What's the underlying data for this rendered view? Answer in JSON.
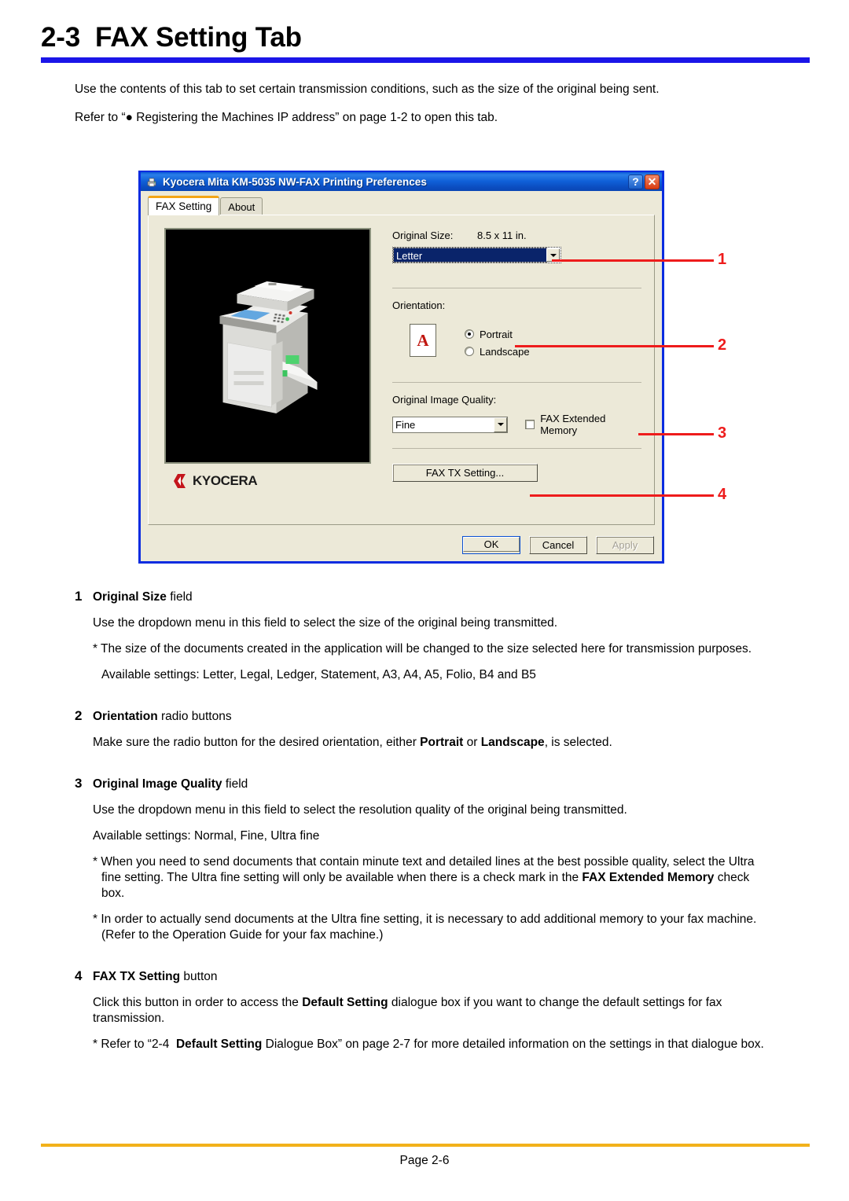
{
  "document": {
    "heading_number": "2-3",
    "heading_title": "FAX Setting Tab",
    "heading_full": "2-3  FAX Setting Tab",
    "accent_color": "#1b15e8",
    "footer_rule_color": "#f2b11a",
    "callout_color": "#ee1c1c",
    "footer": "Page 2-6",
    "intro": [
      "Use the contents of this tab to set certain transmission conditions, such as the size of the original being sent.",
      "Refer to “● Registering the Machines IP address” on page 1-2 to open this tab."
    ]
  },
  "dialog": {
    "title": "Kyocera Mita KM-5035 NW-FAX Printing Preferences",
    "title_icon": "printer-icon",
    "help_button": "?",
    "close_button": "✕",
    "tabs": [
      {
        "label": "FAX Setting",
        "active": true
      },
      {
        "label": "About",
        "active": false
      }
    ],
    "preview": {
      "image_alt": "kyocera-mfp-device",
      "logo_text": "KYOCERA",
      "logo_mark_color": "#c4161c"
    },
    "original_size": {
      "label": "Original Size:",
      "dimension": "8.5 x 11 in.",
      "value": "Letter",
      "options": [
        "Letter",
        "Legal",
        "Ledger",
        "Statement",
        "A3",
        "A4",
        "A5",
        "Folio",
        "B4",
        "B5"
      ],
      "highlight_color": "#0a246a"
    },
    "orientation": {
      "label": "Orientation:",
      "icon_letter": "A",
      "icon_letter_color": "#c0160f",
      "options": [
        {
          "label": "Portrait",
          "selected": true
        },
        {
          "label": "Landscape",
          "selected": false
        }
      ]
    },
    "image_quality": {
      "label": "Original Image Quality:",
      "value": "Fine",
      "options": [
        "Normal",
        "Fine",
        "Ultra fine"
      ],
      "checkbox_label": "FAX Extended Memory",
      "checkbox_checked": false
    },
    "fax_tx_button": "FAX TX Setting...",
    "footer_buttons": [
      {
        "label": "OK",
        "state": "default"
      },
      {
        "label": "Cancel",
        "state": "normal"
      },
      {
        "label": "Apply",
        "state": "disabled"
      }
    ]
  },
  "callouts": [
    {
      "number": "1"
    },
    {
      "number": "2"
    },
    {
      "number": "3"
    },
    {
      "number": "4"
    }
  ],
  "sections": [
    {
      "number": "1",
      "title_bold": "Original Size",
      "title_rest": " field",
      "paras": [
        {
          "text": "Use the dropdown menu in this field to select the size of the original being transmitted.",
          "style": "plain"
        },
        {
          "text": "* The size of the documents created in the application will be changed to the size selected here for transmission purposes.",
          "style": "star"
        },
        {
          "text": "Available settings: Letter, Legal, Ledger, Statement, A3, A4, A5, Folio, B4 and B5",
          "style": "indent"
        }
      ]
    },
    {
      "number": "2",
      "title_bold": "Orientation",
      "title_rest": " radio buttons",
      "paras": [
        {
          "text": "Make sure the radio button for the desired orientation, either Portrait or Landscape, is selected.",
          "style": "rich-orientation"
        }
      ]
    },
    {
      "number": "3",
      "title_bold": "Original Image Quality",
      "title_rest": " field",
      "paras": [
        {
          "text": "Use the dropdown menu in this field to select the resolution quality of the original being transmitted.",
          "style": "plain"
        },
        {
          "text": "Available settings: Normal, Fine, Ultra fine",
          "style": "plain"
        },
        {
          "text": "* When you need to send documents that contain minute text and detailed lines at the best possible quality, select the Ultra fine setting. The Ultra fine setting will only be available when there is a check mark in the FAX Extended Memory check box.",
          "style": "rich-memory"
        },
        {
          "text": "* In order to actually send documents at the Ultra fine setting, it is necessary to add additional memory to your fax machine. (Refer to the Operation Guide for your fax machine.)",
          "style": "star"
        }
      ]
    },
    {
      "number": "4",
      "title_bold": "FAX TX Setting",
      "title_rest": " button",
      "paras": [
        {
          "text": "Click this button in order to access the Default Setting dialogue box if you want to change the default settings for fax transmission.",
          "style": "rich-default"
        },
        {
          "text": "* Refer to “2-4  Default Setting Dialogue Box” on page 2-7 for more detailed information on the settings in that dialogue box.",
          "style": "rich-refer"
        }
      ]
    }
  ]
}
